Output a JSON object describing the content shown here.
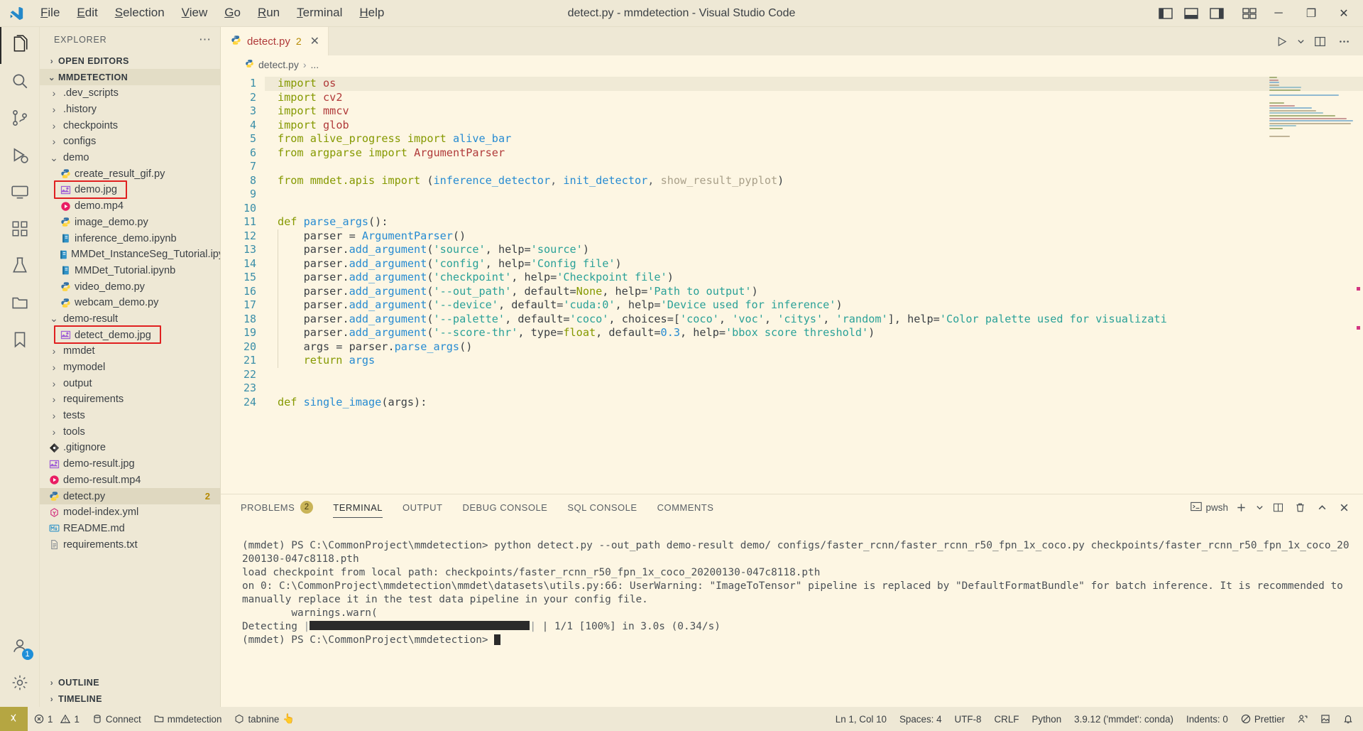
{
  "window": {
    "title": "detect.py - mmdetection - Visual Studio Code",
    "menu": [
      "File",
      "Edit",
      "Selection",
      "View",
      "Go",
      "Run",
      "Terminal",
      "Help"
    ],
    "controls": {
      "minimize": "─",
      "maximize": "❐",
      "close": "✕"
    }
  },
  "activitybar": {
    "items": [
      {
        "name": "explorer",
        "icon": "files-icon",
        "badge": ""
      },
      {
        "name": "search",
        "icon": "search-icon",
        "badge": ""
      },
      {
        "name": "source-control",
        "icon": "source-control-icon",
        "badge": ""
      },
      {
        "name": "run-and-debug",
        "icon": "debug-icon",
        "badge": ""
      },
      {
        "name": "remote-explorer",
        "icon": "remote-icon",
        "badge": ""
      },
      {
        "name": "extensions",
        "icon": "extensions-icon",
        "badge": ""
      },
      {
        "name": "testing",
        "icon": "beaker-icon",
        "badge": ""
      },
      {
        "name": "file-browser",
        "icon": "folder-icon",
        "badge": ""
      },
      {
        "name": "bookmarks",
        "icon": "bookmark-icon",
        "badge": ""
      }
    ],
    "bottom": [
      {
        "name": "accounts",
        "icon": "account-icon",
        "badge": "1"
      },
      {
        "name": "settings",
        "icon": "gear-icon",
        "badge": ""
      }
    ]
  },
  "sidebar": {
    "title": "EXPLORER",
    "more": "⋯",
    "sections": {
      "open_editors": "OPEN EDITORS",
      "project": "MMDETECTION",
      "outline": "OUTLINE",
      "timeline": "TIMELINE"
    },
    "tree": [
      {
        "label": ".dev_scripts",
        "type": "folder",
        "depth": 1,
        "expanded": false
      },
      {
        "label": ".history",
        "type": "folder",
        "depth": 1,
        "expanded": false
      },
      {
        "label": "checkpoints",
        "type": "folder",
        "depth": 1,
        "expanded": false
      },
      {
        "label": "configs",
        "type": "folder",
        "depth": 1,
        "expanded": false
      },
      {
        "label": "demo",
        "type": "folder",
        "depth": 1,
        "expanded": true
      },
      {
        "label": "create_result_gif.py",
        "type": "python",
        "depth": 2
      },
      {
        "label": "demo.jpg",
        "type": "image",
        "depth": 2,
        "highlight": true
      },
      {
        "label": "demo.mp4",
        "type": "video",
        "depth": 2
      },
      {
        "label": "image_demo.py",
        "type": "python",
        "depth": 2
      },
      {
        "label": "inference_demo.ipynb",
        "type": "notebook",
        "depth": 2
      },
      {
        "label": "MMDet_InstanceSeg_Tutorial.ipynb",
        "type": "notebook",
        "depth": 2
      },
      {
        "label": "MMDet_Tutorial.ipynb",
        "type": "notebook",
        "depth": 2
      },
      {
        "label": "video_demo.py",
        "type": "python",
        "depth": 2
      },
      {
        "label": "webcam_demo.py",
        "type": "python",
        "depth": 2
      },
      {
        "label": "demo-result",
        "type": "folder",
        "depth": 1,
        "expanded": true
      },
      {
        "label": "detect_demo.jpg",
        "type": "image",
        "depth": 2,
        "highlight": true
      },
      {
        "label": "mmdet",
        "type": "folder",
        "depth": 1,
        "expanded": false
      },
      {
        "label": "mymodel",
        "type": "folder",
        "depth": 1,
        "expanded": false
      },
      {
        "label": "output",
        "type": "folder",
        "depth": 1,
        "expanded": false
      },
      {
        "label": "requirements",
        "type": "folder",
        "depth": 1,
        "expanded": false
      },
      {
        "label": "tests",
        "type": "folder",
        "depth": 1,
        "expanded": false
      },
      {
        "label": "tools",
        "type": "folder",
        "depth": 1,
        "expanded": false
      },
      {
        "label": ".gitignore",
        "type": "git",
        "depth": 1
      },
      {
        "label": "demo-result.jpg",
        "type": "image",
        "depth": 1
      },
      {
        "label": "demo-result.mp4",
        "type": "video",
        "depth": 1
      },
      {
        "label": "detect.py",
        "type": "python",
        "depth": 1,
        "selected": true,
        "badge": "2"
      },
      {
        "label": "model-index.yml",
        "type": "yaml",
        "depth": 1
      },
      {
        "label": "README.md",
        "type": "markdown",
        "depth": 1
      },
      {
        "label": "requirements.txt",
        "type": "text",
        "depth": 1
      }
    ]
  },
  "editor": {
    "tab": {
      "label": "detect.py",
      "badge": "2",
      "close": "✕",
      "icon": "python-icon"
    },
    "actions": [
      "run-icon",
      "chevron-down-icon",
      "split-editor-icon",
      "more-actions-icon"
    ],
    "breadcrumb": {
      "file": "detect.py",
      "sep": "›",
      "rest": "..."
    },
    "cursor_line": 1,
    "lines": [
      {
        "n": 1,
        "tokens": [
          [
            "kw",
            "import"
          ],
          [
            "pl",
            " "
          ],
          [
            "mod",
            "os"
          ]
        ]
      },
      {
        "n": 2,
        "tokens": [
          [
            "kw",
            "import"
          ],
          [
            "pl",
            " "
          ],
          [
            "mod",
            "cv2"
          ]
        ]
      },
      {
        "n": 3,
        "tokens": [
          [
            "kw",
            "import"
          ],
          [
            "pl",
            " "
          ],
          [
            "mod",
            "mmcv"
          ]
        ]
      },
      {
        "n": 4,
        "tokens": [
          [
            "kw",
            "import"
          ],
          [
            "pl",
            " "
          ],
          [
            "mod",
            "glob"
          ]
        ]
      },
      {
        "n": 5,
        "tokens": [
          [
            "kw",
            "from"
          ],
          [
            "pl",
            " "
          ],
          [
            "kw",
            "alive_progress"
          ],
          [
            "pl",
            " "
          ],
          [
            "kw",
            "import"
          ],
          [
            "pl",
            " "
          ],
          [
            "fn",
            "alive_bar"
          ]
        ]
      },
      {
        "n": 6,
        "tokens": [
          [
            "kw",
            "from"
          ],
          [
            "pl",
            " "
          ],
          [
            "kw",
            "argparse"
          ],
          [
            "pl",
            " "
          ],
          [
            "kw",
            "import"
          ],
          [
            "pl",
            " "
          ],
          [
            "mod",
            "ArgumentParser"
          ]
        ]
      },
      {
        "n": 7,
        "tokens": []
      },
      {
        "n": 8,
        "tokens": [
          [
            "kw",
            "from"
          ],
          [
            "pl",
            " "
          ],
          [
            "kw",
            "mmdet.apis"
          ],
          [
            "pl",
            " "
          ],
          [
            "kw",
            "import"
          ],
          [
            "pl",
            " ("
          ],
          [
            "fn",
            "inference_detector"
          ],
          [
            "op",
            ", "
          ],
          [
            "fn",
            "init_detector"
          ],
          [
            "op",
            ", "
          ],
          [
            "dim",
            "show_result_pyplot"
          ],
          [
            "pl",
            ")"
          ]
        ]
      },
      {
        "n": 9,
        "tokens": []
      },
      {
        "n": 10,
        "tokens": []
      },
      {
        "n": 11,
        "tokens": [
          [
            "def",
            "def"
          ],
          [
            "pl",
            " "
          ],
          [
            "fn",
            "parse_args"
          ],
          [
            "pl",
            "():"
          ]
        ]
      },
      {
        "n": 12,
        "tokens": [
          [
            "pl",
            "    "
          ],
          [
            "ident",
            "parser"
          ],
          [
            "pl",
            " = "
          ],
          [
            "fn",
            "ArgumentParser"
          ],
          [
            "pl",
            "()"
          ]
        ]
      },
      {
        "n": 13,
        "tokens": [
          [
            "pl",
            "    "
          ],
          [
            "ident",
            "parser"
          ],
          [
            "pl",
            "."
          ],
          [
            "fn",
            "add_argument"
          ],
          [
            "pl",
            "("
          ],
          [
            "str",
            "'source'"
          ],
          [
            "pl",
            ", help="
          ],
          [
            "str",
            "'source'"
          ],
          [
            "pl",
            ")"
          ]
        ]
      },
      {
        "n": 14,
        "tokens": [
          [
            "pl",
            "    "
          ],
          [
            "ident",
            "parser"
          ],
          [
            "pl",
            "."
          ],
          [
            "fn",
            "add_argument"
          ],
          [
            "pl",
            "("
          ],
          [
            "str",
            "'config'"
          ],
          [
            "pl",
            ", help="
          ],
          [
            "str",
            "'Config file'"
          ],
          [
            "pl",
            ")"
          ]
        ]
      },
      {
        "n": 15,
        "tokens": [
          [
            "pl",
            "    "
          ],
          [
            "ident",
            "parser"
          ],
          [
            "pl",
            "."
          ],
          [
            "fn",
            "add_argument"
          ],
          [
            "pl",
            "("
          ],
          [
            "str",
            "'checkpoint'"
          ],
          [
            "pl",
            ", help="
          ],
          [
            "str",
            "'Checkpoint file'"
          ],
          [
            "pl",
            ")"
          ]
        ]
      },
      {
        "n": 16,
        "tokens": [
          [
            "pl",
            "    "
          ],
          [
            "ident",
            "parser"
          ],
          [
            "pl",
            "."
          ],
          [
            "fn",
            "add_argument"
          ],
          [
            "pl",
            "("
          ],
          [
            "str",
            "'--out_path'"
          ],
          [
            "pl",
            ", default="
          ],
          [
            "kw",
            "None"
          ],
          [
            "pl",
            ", help="
          ],
          [
            "str",
            "'Path to output'"
          ],
          [
            "pl",
            ")"
          ]
        ]
      },
      {
        "n": 17,
        "tokens": [
          [
            "pl",
            "    "
          ],
          [
            "ident",
            "parser"
          ],
          [
            "pl",
            "."
          ],
          [
            "fn",
            "add_argument"
          ],
          [
            "pl",
            "("
          ],
          [
            "str",
            "'--device'"
          ],
          [
            "pl",
            ", default="
          ],
          [
            "str",
            "'cuda:0'"
          ],
          [
            "pl",
            ", help="
          ],
          [
            "str",
            "'Device used for inference'"
          ],
          [
            "pl",
            ")"
          ]
        ]
      },
      {
        "n": 18,
        "tokens": [
          [
            "pl",
            "    "
          ],
          [
            "ident",
            "parser"
          ],
          [
            "pl",
            "."
          ],
          [
            "fn",
            "add_argument"
          ],
          [
            "pl",
            "("
          ],
          [
            "str",
            "'--palette'"
          ],
          [
            "pl",
            ", default="
          ],
          [
            "str",
            "'coco'"
          ],
          [
            "pl",
            ", choices=["
          ],
          [
            "str",
            "'coco'"
          ],
          [
            "pl",
            ", "
          ],
          [
            "str",
            "'voc'"
          ],
          [
            "pl",
            ", "
          ],
          [
            "str",
            "'citys'"
          ],
          [
            "pl",
            ", "
          ],
          [
            "str",
            "'random'"
          ],
          [
            "pl",
            "], help="
          ],
          [
            "str",
            "'Color palette used for visualizati"
          ]
        ]
      },
      {
        "n": 19,
        "tokens": [
          [
            "pl",
            "    "
          ],
          [
            "ident",
            "parser"
          ],
          [
            "pl",
            "."
          ],
          [
            "fn",
            "add_argument"
          ],
          [
            "pl",
            "("
          ],
          [
            "str",
            "'--score-thr'"
          ],
          [
            "pl",
            ", type="
          ],
          [
            "kw",
            "float"
          ],
          [
            "pl",
            ", default="
          ],
          [
            "num",
            "0.3"
          ],
          [
            "pl",
            ", help="
          ],
          [
            "str",
            "'bbox score threshold'"
          ],
          [
            "pl",
            ")"
          ]
        ]
      },
      {
        "n": 20,
        "tokens": [
          [
            "pl",
            "    "
          ],
          [
            "ident",
            "args"
          ],
          [
            "pl",
            " = "
          ],
          [
            "ident",
            "parser"
          ],
          [
            "pl",
            "."
          ],
          [
            "fn",
            "parse_args"
          ],
          [
            "pl",
            "()"
          ]
        ]
      },
      {
        "n": 21,
        "tokens": [
          [
            "pl",
            "    "
          ],
          [
            "kw",
            "return"
          ],
          [
            "pl",
            " "
          ],
          [
            "fn",
            "args"
          ]
        ]
      },
      {
        "n": 22,
        "tokens": []
      },
      {
        "n": 23,
        "tokens": []
      },
      {
        "n": 24,
        "tokens": [
          [
            "def",
            "def"
          ],
          [
            "pl",
            " "
          ],
          [
            "fn",
            "single_image"
          ],
          [
            "pl",
            "(args):"
          ]
        ]
      }
    ]
  },
  "panel": {
    "tabs": [
      {
        "label": "PROBLEMS",
        "badge": "2",
        "active": false
      },
      {
        "label": "TERMINAL",
        "badge": "",
        "active": true
      },
      {
        "label": "OUTPUT",
        "badge": "",
        "active": false
      },
      {
        "label": "DEBUG CONSOLE",
        "badge": "",
        "active": false
      },
      {
        "label": "SQL CONSOLE",
        "badge": "",
        "active": false
      },
      {
        "label": "COMMENTS",
        "badge": "",
        "active": false
      }
    ],
    "shell": "pwsh",
    "actions": [
      "new-terminal-icon",
      "chevron-down-icon",
      "split-terminal-icon",
      "trash-icon",
      "maximize-panel-icon",
      "close-panel-icon"
    ],
    "terminal_lines": [
      "(mmdet) PS C:\\CommonProject\\mmdetection> python detect.py --out_path demo-result demo/ configs/faster_rcnn/faster_rcnn_r50_fpn_1x_coco.py checkpoints/faster_rcnn_r50_fpn_1x_coco_20200130-047c8118.pth",
      "load checkpoint from local path: checkpoints/faster_rcnn_r50_fpn_1x_coco_20200130-047c8118.pth",
      "on 0: C:\\CommonProject\\mmdetection\\mmdet\\datasets\\utils.py:66: UserWarning: \"ImageToTensor\" pipeline is replaced by \"DefaultFormatBundle\" for batch inference. It is recommended to manually replace it in the test data pipeline in your config file.",
      "        warnings.warn("
    ],
    "progress": {
      "label": "Detecting",
      "stats": "| 1/1 [100%] in 3.0s (0.34/s)"
    },
    "prompt": "(mmdet) PS C:\\CommonProject\\mmdetection>"
  },
  "statusbar": {
    "remote_icon": "remote-icon",
    "left": [
      {
        "name": "problems",
        "icon": "error-icon",
        "errors": "1",
        "warnings": "1"
      },
      {
        "name": "connect",
        "icon": "database-icon",
        "label": "Connect"
      },
      {
        "name": "folder",
        "icon": "folder-icon",
        "label": "mmdetection"
      },
      {
        "name": "tabnine",
        "icon": "tabnine-icon",
        "label": "tabnine",
        "suffix": "👆"
      }
    ],
    "right": [
      {
        "name": "cursor-position",
        "label": "Ln 1, Col 10"
      },
      {
        "name": "indentation",
        "label": "Spaces: 4"
      },
      {
        "name": "encoding",
        "label": "UTF-8"
      },
      {
        "name": "eol",
        "label": "CRLF"
      },
      {
        "name": "language-mode",
        "label": "Python"
      },
      {
        "name": "python-interpreter",
        "label": "3.9.12 ('mmdet': conda)"
      },
      {
        "name": "indents",
        "label": "Indents: 0"
      },
      {
        "name": "prettier",
        "label": "Prettier",
        "icon": "prettier-icon"
      }
    ]
  },
  "colors": {
    "background": "#fdf6e3",
    "chrome": "#eee8d5",
    "accent_red": "#b03a3a",
    "accent_blue": "#268bd2",
    "accent_green": "#859900",
    "accent_yellow": "#b58900",
    "highlight_box": "#e02020",
    "remote_badge": "#b5a642"
  }
}
